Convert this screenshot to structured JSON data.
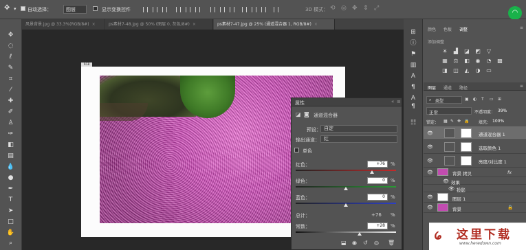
{
  "options_bar": {
    "auto_select_label": "自动选择：",
    "auto_select_value": "图层",
    "show_transform_label": "显示变换控件",
    "mode_3d": "3D 模式："
  },
  "doc_tabs": [
    {
      "label": "风景背景.jpg @ 33.3%(RGB/8#)",
      "active": false
    },
    {
      "label": "ps素材7-48.jpg @ 50% (图层 0, 灰色/8#)",
      "active": false
    },
    {
      "label": "ps素材7-47.jpg @ 25% (通道混合器 1, RGB/8#)",
      "active": true
    }
  ],
  "canvas_tag": "RGB",
  "properties": {
    "panel_title": "属性",
    "adj_name": "通道混合器",
    "preset_label": "预设：",
    "preset_value": "自定",
    "output_label": "输出通道：",
    "output_value": "红",
    "mono_label": "单色",
    "red": {
      "label": "红色：",
      "value": "+76",
      "unit": "%",
      "level": 0.76
    },
    "green": {
      "label": "绿色：",
      "value": "0",
      "unit": "%",
      "level": 0.5
    },
    "blue": {
      "label": "蓝色：",
      "value": "0",
      "unit": "%",
      "level": 0.5
    },
    "total": {
      "label": "总计：",
      "value": "+76",
      "unit": "%"
    },
    "constant": {
      "label": "常数：",
      "value": "+28",
      "unit": "%",
      "level": 0.64
    }
  },
  "right_panel": {
    "top_tabs": [
      {
        "label": "颜色",
        "active": false
      },
      {
        "label": "色板",
        "active": false
      },
      {
        "label": "调整",
        "active": true
      }
    ],
    "adjust_add_label": "添加调整",
    "layer_tabs": [
      {
        "label": "图层",
        "active": true
      },
      {
        "label": "通道",
        "active": false
      },
      {
        "label": "路径",
        "active": false
      }
    ],
    "filter_kind": "类型",
    "blend_mode": "正常",
    "opacity_label": "不透明度：",
    "opacity_value": "39%",
    "lock_label": "锁定：",
    "fill_label": "填充：",
    "fill_value": "100%",
    "layers": [
      {
        "name": "通道混合器 1",
        "selected": true
      },
      {
        "name": "选取颜色 1",
        "selected": false
      },
      {
        "name": "亮度/对比度 1",
        "selected": false
      },
      {
        "name": "背景 拷贝",
        "selected": false,
        "fx": "fx"
      },
      {
        "name": "效果",
        "selected": false,
        "sub": true
      },
      {
        "name": "投影",
        "selected": false,
        "sub": true
      },
      {
        "name": "图层 1",
        "selected": false
      },
      {
        "name": "背景",
        "selected": false
      }
    ]
  },
  "watermark": {
    "title": "这里下载",
    "url": "www.heredown.com"
  },
  "colors": {
    "panel_bg": "#535353",
    "canvas_bg": "#282828",
    "red_slider": "#c42b2b",
    "green_slider": "#2a9a35",
    "blue_slider": "#2d3fc7",
    "logo_red": "#b02a1f"
  }
}
